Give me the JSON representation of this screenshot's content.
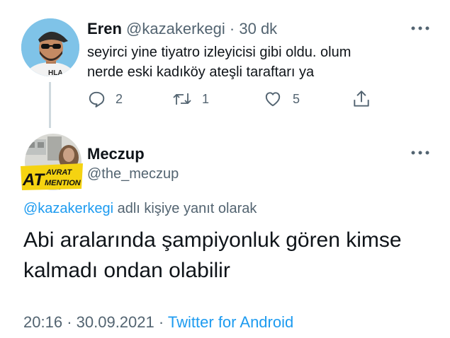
{
  "parent_tweet": {
    "display_name": "Eren",
    "handle": "@kazakerkegi",
    "separator": "·",
    "time_ago": "30 dk",
    "text_line1": "seyirci yine tiyatro izleyicisi gibi oldu. olum",
    "text_line2": "nerde eski kadıköy ateşli taraftarı ya",
    "actions": {
      "reply_count": "2",
      "retweet_count": "1",
      "like_count": "5"
    },
    "avatar": {
      "icon": "person-with-cap-and-sunglasses-avatar",
      "shirt_text": "HLA"
    }
  },
  "reply_tweet": {
    "display_name": "Meczup",
    "handle": "@the_meczup",
    "avatar": {
      "icon": "at-avrat-mention-logo",
      "logo_at": "AT",
      "logo_line1": "AVRAT",
      "logo_line2": "MENTION"
    },
    "replying_to_handle": "@kazakerkegi",
    "replying_to_suffix": "adlı kişiye yanıt olarak",
    "text_line1": "Abi aralarında şampiyonluk gören kimse",
    "text_line2": "kalmadı ondan olabilir",
    "time": "20:16",
    "separator": "·",
    "date": "30.09.2021",
    "separator2": "·",
    "source": "Twitter for Android"
  },
  "colors": {
    "text": "#0f1419",
    "muted": "#536471",
    "link": "#1d9bf0",
    "thread_line": "#cfd9de",
    "logo_yellow": "#f5d311"
  }
}
